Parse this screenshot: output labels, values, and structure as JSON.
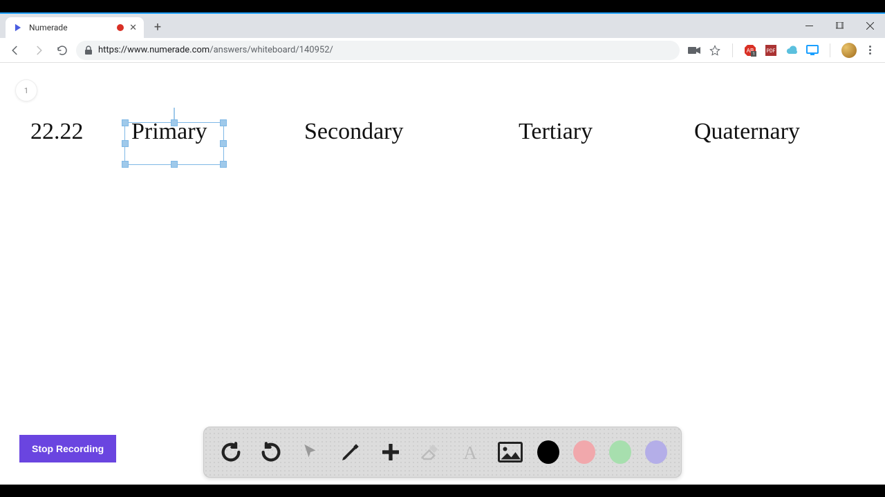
{
  "browser": {
    "tab_title": "Numerade",
    "url_host": "https://www.numerade.com",
    "url_path": "/answers/whiteboard/140952/"
  },
  "page": {
    "slide_number": "1"
  },
  "whiteboard": {
    "number": "22.22",
    "term1": "Primary",
    "term2": "Secondary",
    "term3": "Tertiary",
    "term4": "Quaternary"
  },
  "controls": {
    "stop_recording": "Stop Recording"
  },
  "colors": {
    "swatch1": "#000000",
    "swatch2": "#f1a8ac",
    "swatch3": "#a7dfae",
    "swatch4": "#b4aee8"
  }
}
